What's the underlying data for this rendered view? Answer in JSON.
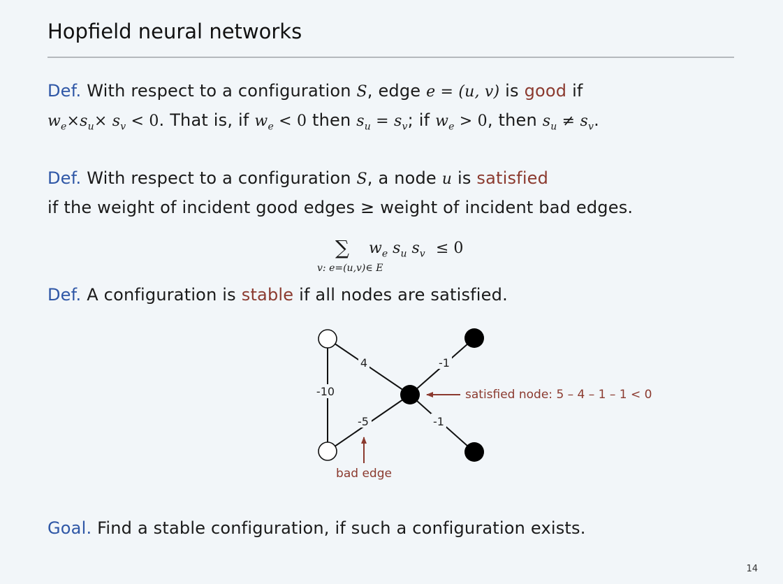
{
  "slide": {
    "title": "Hopfield neural networks",
    "page_number": "14"
  },
  "def1": {
    "label": "Def.",
    "line1_a": "With respect to a configuration",
    "S": "S",
    "line1_b": ", edge",
    "edge_expr": "e = (u, v)",
    "line1_c": "is",
    "good": "good",
    "line1_d": "if",
    "cond_math": "w",
    "line2_b": ". That is, if",
    "line2_c": "then",
    "line2_d": "; if",
    "line2_e": ", then"
  },
  "def2": {
    "label": "Def.",
    "line1_a": "With respect to a configuration",
    "S": "S",
    "line1_b": ", a node",
    "u": "u",
    "line1_c": "is",
    "satisfied": "satisfied",
    "line2": "if the weight of incident good edges ≥ weight of incident bad edges."
  },
  "formula": {
    "sigma": "∑",
    "expr": "w",
    "cmp": "≤  0",
    "subscript": "v: e=(u,v)∈ E"
  },
  "def3": {
    "label": "Def.",
    "a": "A configuration is",
    "stable": "stable",
    "b": "if all nodes are satisfied."
  },
  "diagram": {
    "edge_labels": [
      "4",
      "-1",
      "-10",
      "-5",
      "-1"
    ],
    "satisfied_annotation": "satisfied node:  5 – 4 – 1 – 1 <  0",
    "bad_edge_annotation": "bad edge",
    "annotation_color": "#8b3a2f"
  },
  "goal": {
    "label": "Goal.",
    "text": "Find a stable configuration, if such a configuration exists."
  },
  "colors": {
    "label": "#2f57a6",
    "highlight": "#8b3a2f",
    "background": "#f2f6f9"
  }
}
